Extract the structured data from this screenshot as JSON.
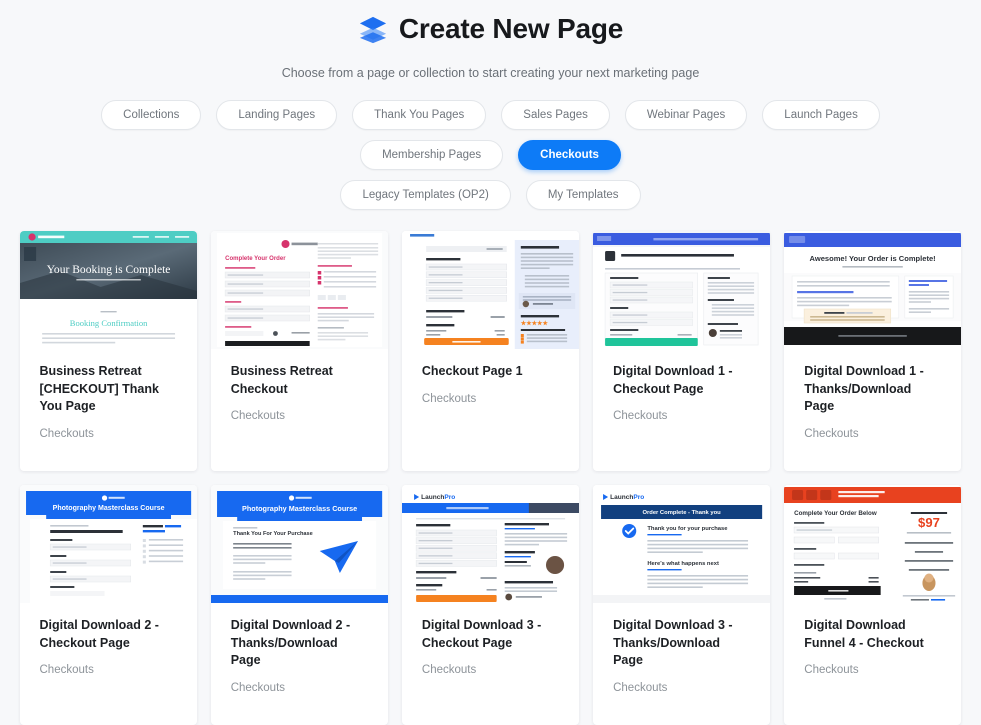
{
  "header": {
    "logo_icon": "layers-icon",
    "title": "Create New Page",
    "subtitle": "Choose from a page or collection to start creating your next marketing page"
  },
  "filters": {
    "row1": [
      {
        "label": "Collections",
        "active": false
      },
      {
        "label": "Landing Pages",
        "active": false
      },
      {
        "label": "Thank You Pages",
        "active": false
      },
      {
        "label": "Sales Pages",
        "active": false
      },
      {
        "label": "Webinar Pages",
        "active": false
      },
      {
        "label": "Launch Pages",
        "active": false
      },
      {
        "label": "Membership Pages",
        "active": false
      },
      {
        "label": "Checkouts",
        "active": true
      }
    ],
    "row2": [
      {
        "label": "Legacy Templates (OP2)",
        "active": false
      },
      {
        "label": "My Templates",
        "active": false
      }
    ],
    "active_accent": "#0d7bf7"
  },
  "templates": [
    {
      "title": "Business Retreat [CHECKOUT] Thank You Page",
      "category": "Checkouts",
      "thumb": {
        "style": "booking-confirmation",
        "accent": "#4ecdc4",
        "heading": "Your Booking is Complete",
        "subheading": "Booking Confirmation"
      }
    },
    {
      "title": "Business Retreat Checkout",
      "category": "Checkouts",
      "thumb": {
        "style": "two-column-form",
        "accent": "#d6336c",
        "heading": "Complete Your Order"
      }
    },
    {
      "title": "Checkout Page 1",
      "category": "Checkouts",
      "thumb": {
        "style": "orange-checkout",
        "accent": "#f58220",
        "panel": "#e8eefb"
      }
    },
    {
      "title": "Digital Download 1 - Checkout Page",
      "category": "Checkouts",
      "thumb": {
        "style": "blue-bar-checkout",
        "accent": "#3a5ce0",
        "button": "#1fc49a"
      }
    },
    {
      "title": "Digital Download 1 - Thanks/Download Page",
      "category": "Checkouts",
      "thumb": {
        "style": "order-complete",
        "accent": "#3a5ce0",
        "heading": "Awesome! Your Order is Complete!"
      }
    },
    {
      "title": "Digital Download 2 - Checkout Page",
      "category": "Checkouts",
      "thumb": {
        "style": "photography-checkout",
        "accent": "#1769f0",
        "heading": "Photography Masterclass Course"
      }
    },
    {
      "title": "Digital Download 2 - Thanks/Download Page",
      "category": "Checkouts",
      "thumb": {
        "style": "photography-thanks",
        "accent": "#1769f0",
        "heading": "Photography Masterclass Course",
        "subheading": "Thank You For Your Purchase"
      }
    },
    {
      "title": "Digital Download 3 - Checkout Page",
      "category": "Checkouts",
      "thumb": {
        "style": "launchpro-checkout",
        "accent": "#1769f0",
        "brand": "LaunchPro",
        "button": "#f58220"
      }
    },
    {
      "title": "Digital Download 3 - Thanks/Download Page",
      "category": "Checkouts",
      "thumb": {
        "style": "launchpro-thanks",
        "accent": "#12407f",
        "brand": "LaunchPro",
        "heading": "Order Complete - Thank you",
        "subheading": "Thank you for your purchase"
      }
    },
    {
      "title": "Digital Download Funnel 4 - Checkout",
      "category": "Checkouts",
      "thumb": {
        "style": "red-timer-checkout",
        "accent": "#e8421f",
        "heading": "Complete Your Order Below",
        "price": "$97"
      }
    }
  ]
}
